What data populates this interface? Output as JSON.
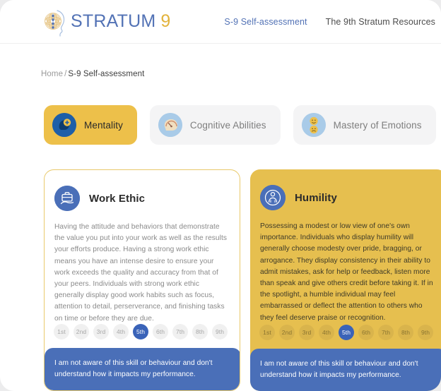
{
  "brand": {
    "logo_icon": "head-mandala-logo-icon",
    "name": "STRATUM",
    "number": "9"
  },
  "nav": {
    "links": [
      {
        "label": "S-9 Self-assessment",
        "active": true
      },
      {
        "label": "The 9th Stratum Resources",
        "active": false
      }
    ]
  },
  "breadcrumb": {
    "home": "Home",
    "separator": "/",
    "current": "S-9 Self-assessment"
  },
  "tabs": [
    {
      "label": "Mentality",
      "icon": "head-plus-icon",
      "selected": true
    },
    {
      "label": "Cognitive Abilities",
      "icon": "brain-gauge-icon",
      "selected": false
    },
    {
      "label": "Mastery of Emotions",
      "icon": "two-faces-icon",
      "selected": false
    },
    {
      "label": "",
      "icon": "handshake-icon",
      "selected": false
    }
  ],
  "cards": [
    {
      "title": "Work Ethic",
      "icon": "briefcase-hand-icon",
      "theme": "light",
      "description": "Having the attitude and behaviors that demonstrate the value you put into your work as well as the results your efforts produce.  Having a strong work ethic means you have an intense desire to ensure your work exceeds the quality and accuracy from that of your peers.  Individuals with strong work ethic generally display good work habits such as focus, attention to detail, perserverance, and finishing tasks on time or before they are due.",
      "scale": [
        "1st",
        "2nd",
        "3rd",
        "4th",
        "5th",
        "6th",
        "7th",
        "8th",
        "9th"
      ],
      "selected_level": "5th",
      "footer": "I am not aware of this skill or behaviour and don't understand how it impacts my performance."
    },
    {
      "title": "Humility",
      "icon": "humble-person-icon",
      "theme": "gold",
      "description": "Possessing a modest or low view of one's own importance. Individuals who display humility will generally choose modesty over pride, bragging, or arrogance. They display consistency in their ability to admit mistakes, ask for help or feedback, listen more than speak and give others credit before taking it. If in the spotlight, a humble individual may feel embarrassed or deflect the attention to others who they feel deserve praise or recognition.",
      "scale": [
        "1st",
        "2nd",
        "3rd",
        "4th",
        "5th",
        "6th",
        "7th",
        "8th",
        "9th"
      ],
      "selected_level": "5th",
      "footer": "I am not aware of this skill or behaviour and don't understand how it impacts my performance."
    }
  ],
  "colors": {
    "brand_blue": "#5272b5",
    "brand_gold": "#e2b33c",
    "tab_selected": "#edc04a",
    "card_gold": "#e6bf4f",
    "footer_blue": "#4a6fb8",
    "accent_dot": "#3a63b8"
  }
}
